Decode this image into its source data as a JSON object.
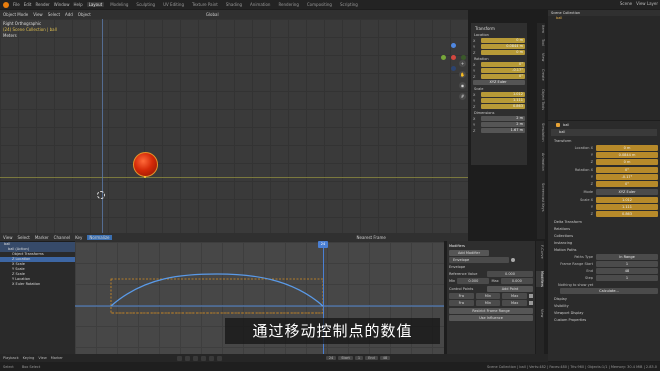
{
  "topbar": {
    "menus": [
      "File",
      "Edit",
      "Render",
      "Window",
      "Help"
    ],
    "workspaces": [
      "Layout",
      "Modeling",
      "Sculpting",
      "UV Editing",
      "Texture Paint",
      "Shading",
      "Animation",
      "Rendering",
      "Compositing",
      "Scripting"
    ],
    "active_workspace": "Layout",
    "scene": "Scene",
    "view_layer": "View Layer"
  },
  "viewport": {
    "mode": "Object Mode",
    "menus": [
      "View",
      "Select",
      "Add",
      "Object"
    ],
    "orientation": "Global",
    "view_name": "Right Orthographic",
    "collection_line": "(24) Scene Collection | ball",
    "unit": "Meters"
  },
  "npanel": {
    "transform_title": "Transform",
    "location_title": "Location",
    "location": [
      {
        "axis": "X",
        "value": "0 m"
      },
      {
        "axis": "Y",
        "value": "0.0844 m"
      },
      {
        "axis": "Z",
        "value": "0 m"
      }
    ],
    "rotation_title": "Rotation",
    "rotation": [
      {
        "axis": "X",
        "value": "0°"
      },
      {
        "axis": "Y",
        "value": "-0.17°"
      },
      {
        "axis": "Z",
        "value": "0°"
      }
    ],
    "rotation_mode": "XYZ Euler",
    "scale_title": "Scale",
    "scale": [
      {
        "axis": "X",
        "value": "1.012"
      },
      {
        "axis": "Y",
        "value": "1.111"
      },
      {
        "axis": "Z",
        "value": "0.863"
      }
    ],
    "dimensions_title": "Dimensions",
    "dimensions": [
      {
        "axis": "X",
        "value": "2 m"
      },
      {
        "axis": "Y",
        "value": "2 m"
      },
      {
        "axis": "Z",
        "value": "1.67 m"
      }
    ],
    "tabs": [
      "Item",
      "Tool",
      "View",
      "Create",
      "Object Tools",
      "Simulation",
      "Animation",
      "Screencast Keys"
    ]
  },
  "outliner": {
    "title": "Scene Collection",
    "items": [
      "ball"
    ]
  },
  "properties": {
    "object_name": "ball",
    "sub_name": "ball",
    "transform_title": "Transform",
    "location_label": "Location X",
    "location": [
      "0 m",
      "0.0844 m",
      "0 m"
    ],
    "rotation_label": "Rotation X",
    "rotation": [
      "0°",
      "-0.17°",
      "0°"
    ],
    "mode_label": "Mode",
    "mode_value": "XYZ Euler",
    "scale_label": "Scale X",
    "scale": [
      "1.012",
      "1.111",
      "0.863"
    ],
    "sections": [
      "Delta Transform",
      "Relations",
      "Collections",
      "Instancing",
      "Motion Paths"
    ],
    "motion_paths": {
      "paths_type_label": "Paths Type",
      "paths_type_value": "In Range",
      "frame_range_label": "Frame Range Start",
      "frame_start": "1",
      "end_label": "End",
      "frame_end": "48",
      "step_label": "Step",
      "frame_step": "1"
    },
    "nothing_to_show": "Nothing to show yet",
    "calculate_button": "Calculate...",
    "sections_bottom": [
      "Display",
      "Visibility",
      "Viewport Display",
      "Custom Properties"
    ]
  },
  "graph_editor": {
    "menus": [
      "View",
      "Select",
      "Marker",
      "Channel",
      "Key"
    ],
    "mode_label": "Normalize",
    "pivot_label": "Nearest Frame",
    "ruler_ticks": [
      "0",
      "4",
      "8",
      "12",
      "16",
      "20",
      "24",
      "28",
      "32",
      "36",
      "40",
      "44",
      "48"
    ],
    "current_frame": "24",
    "channels": [
      {
        "label": "ball",
        "style": "dark"
      },
      {
        "label": "ball (Action)",
        "style": "dark"
      },
      {
        "label": "Object Transforms",
        "style": "plain"
      },
      {
        "label": "Z Location",
        "style": "sel"
      },
      {
        "label": "X Scale",
        "style": "plain"
      },
      {
        "label": "Y Scale",
        "style": "plain"
      },
      {
        "label": "Z Scale",
        "style": "plain"
      },
      {
        "label": "Y Location",
        "style": "plain"
      },
      {
        "label": "X Euler Rotation",
        "style": "plain"
      }
    ]
  },
  "modifiers_panel": {
    "title": "Modifiers",
    "add_modifier": "Add Modifier",
    "modifier_name": "Envelope",
    "section": "Envelope",
    "reference_label": "Reference Value",
    "reference_value": "0.000",
    "min_label": "Min",
    "min_value": "0.000",
    "max_label": "Max",
    "max_value": "0.000",
    "control_points_label": "Control Points",
    "add_point": "Add Point",
    "point_row": [
      "Fra",
      "Min",
      "Max"
    ],
    "restrict_frame_range": "Restrict Frame Range",
    "use_influence": "Use Influence",
    "tabs": [
      "F-Curve",
      "Modifiers",
      "View"
    ]
  },
  "subtitle": "通过移动控制点的数值",
  "playbar": {
    "items": [
      "Playback",
      "Keying",
      "View",
      "Marker"
    ],
    "frame": "24",
    "start_label": "Start",
    "start": "1",
    "end_label": "End",
    "end": "48"
  },
  "statusbar": {
    "select": "Select",
    "box_select": "Box Select",
    "stats": "Scene Collection | ball | Verts:482 | Faces:480 | Tris:960 | Objects:1/1 | Memory: 30.4 MiB | 2.83.0"
  }
}
